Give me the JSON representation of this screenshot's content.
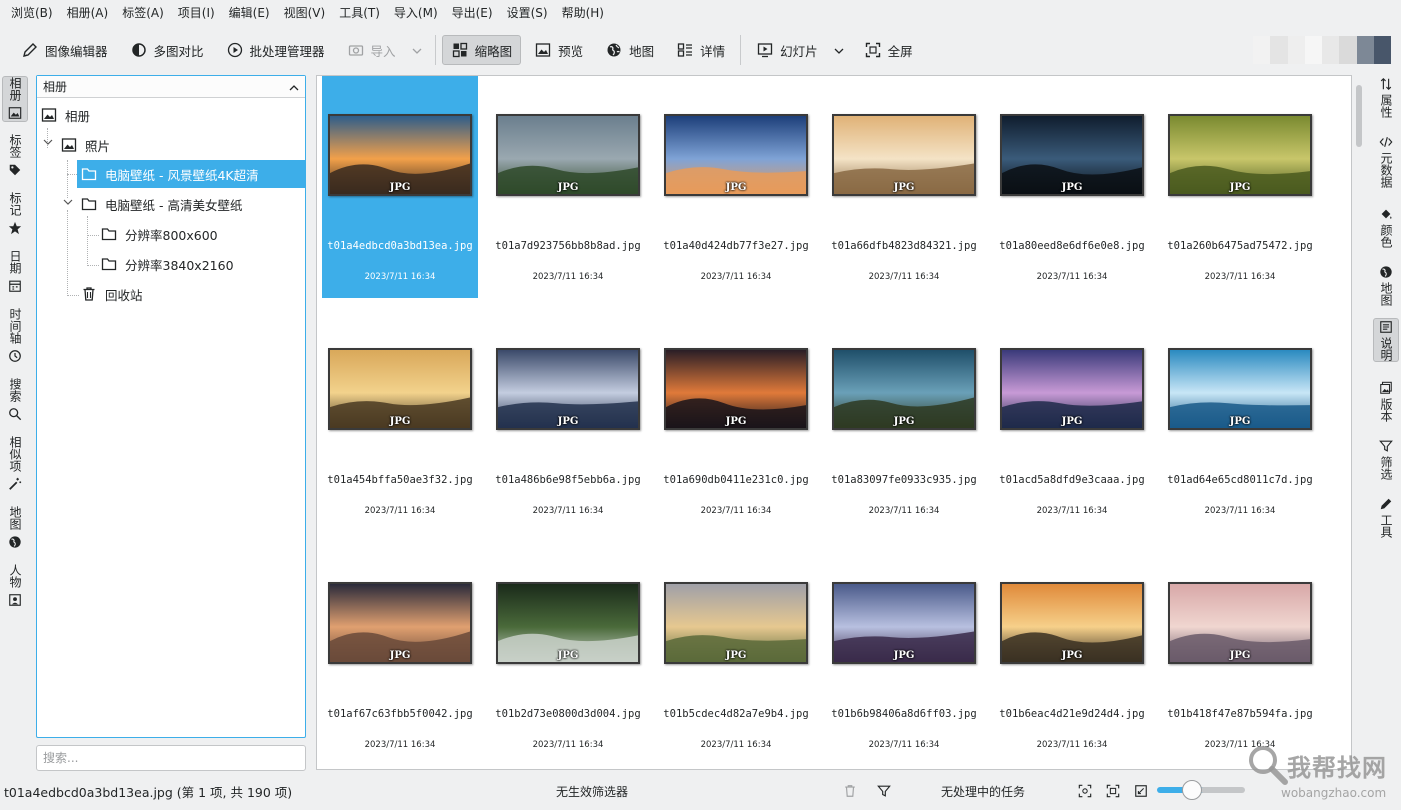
{
  "menubar": [
    "浏览(B)",
    "相册(A)",
    "标签(A)",
    "项目(I)",
    "编辑(E)",
    "视图(V)",
    "工具(T)",
    "导入(M)",
    "导出(E)",
    "设置(S)",
    "帮助(H)"
  ],
  "toolbar": {
    "image_editor": "图像编辑器",
    "light_table": "多图对比",
    "batch_queue": "批处理管理器",
    "import": "导入",
    "thumbnails": "缩略图",
    "preview": "预览",
    "map": "地图",
    "details": "详情",
    "slideshow": "幻灯片",
    "fullscreen": "全屏"
  },
  "left_tabs": [
    "相册",
    "标签",
    "标记",
    "日期",
    "时间轴",
    "搜索",
    "相似项",
    "地图",
    "人物"
  ],
  "right_tabs": [
    "属性",
    "元数据",
    "颜色",
    "地图",
    "说明",
    "版本",
    "筛选",
    "工具"
  ],
  "album_panel": {
    "header": "相册",
    "tree": [
      "相册",
      "照片",
      "电脑壁纸 - 风景壁纸4K超清",
      "电脑壁纸 - 高清美女壁纸",
      "分辨率800x600",
      "分辨率3840x2160",
      "回收站"
    ]
  },
  "search": {
    "placeholder": "搜索..."
  },
  "thumbnails": [
    {
      "name": "t01a4edbcd0a3bd13ea.jpg",
      "date": "2023/7/11 16:34",
      "badge": "JPG",
      "selected": true
    },
    {
      "name": "t01a7d923756bb8b8ad.jpg",
      "date": "2023/7/11 16:34",
      "badge": "JPG"
    },
    {
      "name": "t01a40d424db77f3e27.jpg",
      "date": "2023/7/11 16:34",
      "badge": "JPG"
    },
    {
      "name": "t01a66dfb4823d84321.jpg",
      "date": "2023/7/11 16:34",
      "badge": "JPG"
    },
    {
      "name": "t01a80eed8e6df6e0e8.jpg",
      "date": "2023/7/11 16:34",
      "badge": "JPG"
    },
    {
      "name": "t01a260b6475ad75472.jpg",
      "date": "2023/7/11 16:34",
      "badge": "JPG"
    },
    {
      "name": "t01a454bffa50ae3f32.jpg",
      "date": "2023/7/11 16:34",
      "badge": "JPG"
    },
    {
      "name": "t01a486b6e98f5ebb6a.jpg",
      "date": "2023/7/11 16:34",
      "badge": "JPG"
    },
    {
      "name": "t01a690db0411e231c0.jpg",
      "date": "2023/7/11 16:34",
      "badge": "JPG"
    },
    {
      "name": "t01a83097fe0933c935.jpg",
      "date": "2023/7/11 16:34",
      "badge": "JPG"
    },
    {
      "name": "t01acd5a8dfd9e3caaa.jpg",
      "date": "2023/7/11 16:34",
      "badge": "JPG"
    },
    {
      "name": "t01ad64e65cd8011c7d.jpg",
      "date": "2023/7/11 16:34",
      "badge": "JPG"
    },
    {
      "name": "t01af67c63fbb5f0042.jpg",
      "date": "2023/7/11 16:34",
      "badge": "JPG"
    },
    {
      "name": "t01b2d73e0800d3d004.jpg",
      "date": "2023/7/11 16:34",
      "badge": "JPG"
    },
    {
      "name": "t01b5cdec4d82a7e9b4.jpg",
      "date": "2023/7/11 16:34",
      "badge": "JPG"
    },
    {
      "name": "t01b6b98406a8d6ff03.jpg",
      "date": "2023/7/11 16:34",
      "badge": "JPG"
    },
    {
      "name": "t01b6eac4d21e9d24d4.jpg",
      "date": "2023/7/11 16:34",
      "badge": "JPG"
    },
    {
      "name": "t01b418f47e87b594fa.jpg",
      "date": "2023/7/11 16:34",
      "badge": "JPG"
    }
  ],
  "statusbar": {
    "file_info": "t01a4edbcd0a3bd13ea.jpg (第 1 项, 共 190 项)",
    "filter": "无生效筛选器",
    "tasks": "无处理中的任务"
  },
  "watermark": {
    "main": "我帮找网",
    "sub": "wobangzhao.com"
  },
  "colors": {
    "accent": "#3daee9",
    "window": "#eff0f1"
  }
}
